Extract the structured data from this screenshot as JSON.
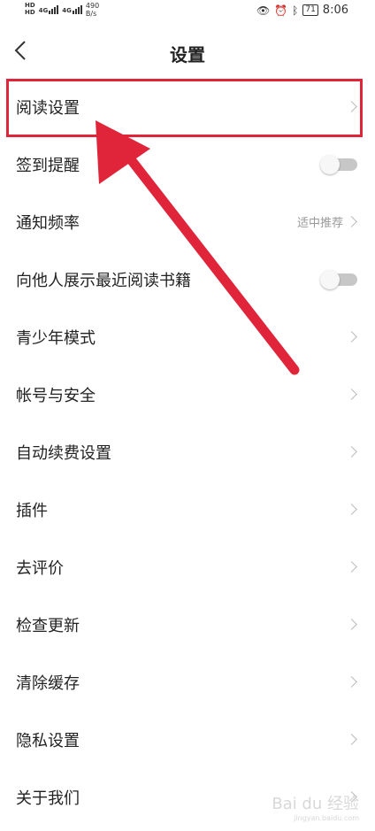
{
  "status_bar": {
    "network_speed": "490",
    "speed_unit": "B/s",
    "hd1": "HD",
    "hd2": "HD",
    "net_type1": "4G",
    "net_type2": "4G",
    "battery": "71",
    "time": "8:06"
  },
  "header": {
    "title": "设置"
  },
  "items": [
    {
      "label": "阅读设置",
      "type": "link"
    },
    {
      "label": "签到提醒",
      "type": "toggle",
      "on": false
    },
    {
      "label": "通知频率",
      "type": "link",
      "value": "适中推荐"
    },
    {
      "label": "向他人展示最近阅读书籍",
      "type": "toggle",
      "on": false
    },
    {
      "label": "青少年模式",
      "type": "link"
    },
    {
      "label": "帐号与安全",
      "type": "link"
    },
    {
      "label": "自动续费设置",
      "type": "link"
    },
    {
      "label": "插件",
      "type": "link"
    },
    {
      "label": "去评价",
      "type": "link"
    },
    {
      "label": "检查更新",
      "type": "link"
    },
    {
      "label": "清除缓存",
      "type": "link"
    },
    {
      "label": "隐私设置",
      "type": "link"
    },
    {
      "label": "关于我们",
      "type": "link"
    }
  ],
  "annotation": {
    "color": "#e0253a"
  },
  "watermark": {
    "text": "Bai du 经验",
    "sub": "jingyan.baidu.com"
  }
}
